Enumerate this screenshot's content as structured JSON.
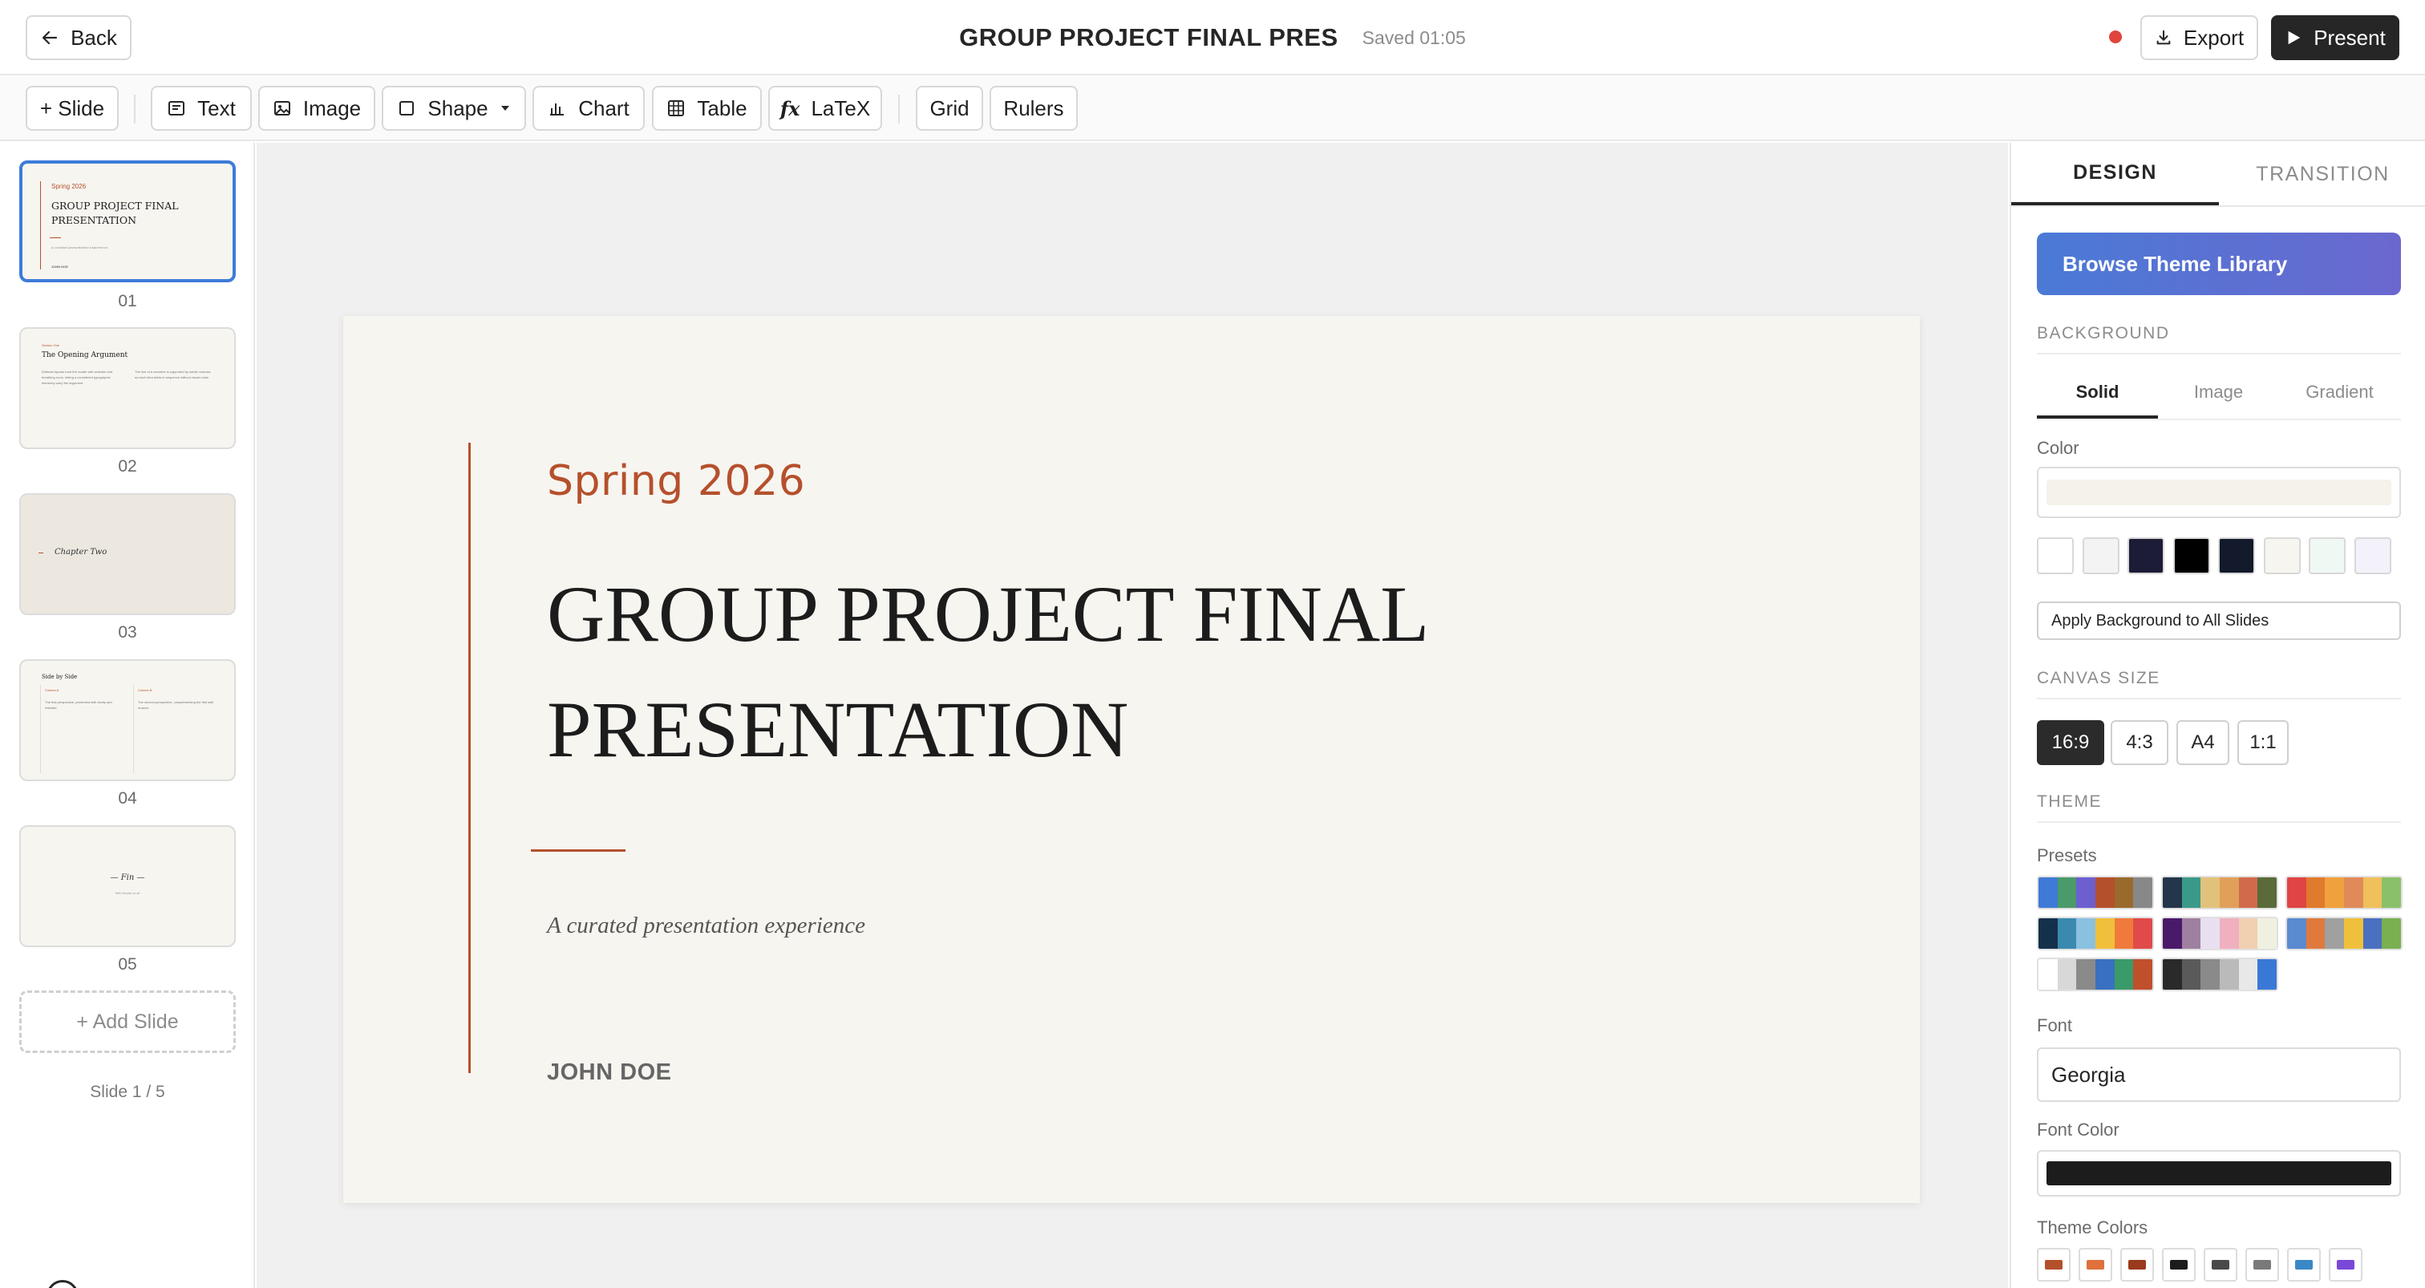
{
  "header": {
    "back_label": "Back",
    "doc_title": "GROUP PROJECT FINAL PRES",
    "saved_status": "Saved 01:05",
    "export_label": "Export",
    "present_label": "Present",
    "recording_color": "#e0443c"
  },
  "toolbar": {
    "add_slide": "+ Slide",
    "text": "Text",
    "image": "Image",
    "shape": "Shape",
    "chart": "Chart",
    "table": "Table",
    "latex_prefix": "fx",
    "latex": "LaTeX",
    "grid": "Grid",
    "rulers": "Rulers"
  },
  "slides_panel": {
    "thumbnails": [
      {
        "num": "01",
        "eyebrow": "Spring 2026",
        "title_line1": "GROUP PROJECT FINAL",
        "title_line2": "PRESENTATION",
        "subtitle": "A curated presentation experience",
        "author": "JOHN DOE"
      },
      {
        "num": "02",
        "eyebrow": "Section One",
        "title": "The Opening Argument",
        "col1": "Editorial layouts trust the reader with restraint and breathing room, letting a considered typographic hierarchy carry the argument.",
        "col2": "The line of a narrative is supported by subtle contrast, so each idea lands in sequence without visual noise."
      },
      {
        "num": "03",
        "title": "Chapter Two"
      },
      {
        "num": "04",
        "title": "Side by Side",
        "left_label": "Column A",
        "right_label": "Column B",
        "left_text": "The first perspective, presented with clarity and restraint.",
        "right_text": "The second perspective, complementing the first with nuance."
      },
      {
        "num": "05",
        "title": "— Fin —",
        "subtitle": "With thanks to all"
      }
    ],
    "add_slide_label": "+ Add Slide",
    "slide_count": "Slide 1 / 5"
  },
  "slide": {
    "eyebrow": "Spring 2026",
    "title_line1": "GROUP PROJECT FINAL",
    "title_line2": "PRESENTATION",
    "subtitle": "A curated presentation experience",
    "author": "JOHN DOE",
    "accent_color": "#b5502c",
    "background_color": "#f7f5f0"
  },
  "design_panel": {
    "tabs": [
      {
        "label": "DESIGN",
        "active": true
      },
      {
        "label": "TRANSITION",
        "active": false
      }
    ],
    "browse_label": "Browse Theme Library",
    "background": {
      "heading": "BACKGROUND",
      "tabs": [
        {
          "label": "Solid",
          "active": true
        },
        {
          "label": "Image",
          "active": false
        },
        {
          "label": "Gradient",
          "active": false
        }
      ],
      "color_label": "Color",
      "current_color": "#f4f2ea",
      "swatches": [
        "#ffffff",
        "#f3f3f3",
        "#1c1c36",
        "#000000",
        "#121a2b",
        "#f6f5f0",
        "#eff8f3",
        "#f3f2fa"
      ],
      "apply_label": "Apply Background to All Slides"
    },
    "canvas_size": {
      "heading": "CANVAS SIZE",
      "options": [
        {
          "label": "16:9",
          "active": true
        },
        {
          "label": "4:3",
          "active": false
        },
        {
          "label": "A4",
          "active": false
        },
        {
          "label": "1:1",
          "active": false
        }
      ]
    },
    "theme": {
      "heading": "THEME",
      "presets_label": "Presets",
      "presets": [
        [
          "#3f7ad6",
          "#4a9a6a",
          "#6d5fcf",
          "#b5502c",
          "#9a6a2c",
          "#888888"
        ],
        [
          "#24364a",
          "#3a9a8a",
          "#e2c27a",
          "#e0a05a",
          "#d06a4a",
          "#5a6a3a"
        ],
        [
          "#e04444",
          "#e07a2c",
          "#f0a03c",
          "#e08a5a",
          "#f0c05a",
          "#8ac06a"
        ],
        [
          "#14304a",
          "#3a8ab0",
          "#8ac0e0",
          "#f0c03c",
          "#f07a3c",
          "#e04a4a"
        ],
        [
          "#4a1a6a",
          "#a080a0",
          "#e8e0f0",
          "#f0b0c0",
          "#f0d0b0",
          "#f0f0e0"
        ],
        [
          "#5a8ad0",
          "#e07a3c",
          "#a0a0a0",
          "#f0c03c",
          "#4a70c0",
          "#7ab050"
        ],
        [
          "#ffffff",
          "#d8d8d8",
          "#8a8a8a",
          "#3a70c0",
          "#3a9a6a",
          "#c0502c"
        ],
        [
          "#2a2a2a",
          "#5a5a5a",
          "#8a8a8a",
          "#bababa",
          "#e8e8e8",
          "#3a78d6"
        ]
      ],
      "font_label": "Font",
      "font_value": "Georgia",
      "font_color_label": "Font Color",
      "font_color": "#1c1c1c",
      "theme_colors_label": "Theme Colors",
      "theme_colors": [
        "#b5502c",
        "#e0703c",
        "#9a3a1c",
        "#1c1c1c",
        "#4a4a4a",
        "#7a7a7a",
        "#3a88c8",
        "#7a48d8"
      ]
    }
  }
}
